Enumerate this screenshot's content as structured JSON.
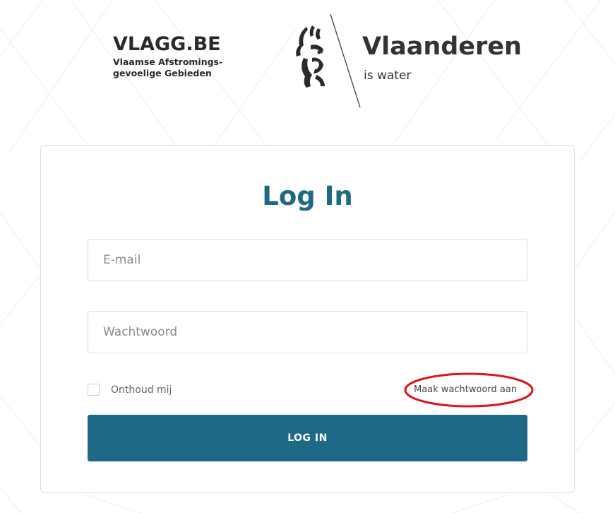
{
  "brand": {
    "vlagg_title": "VLAGG.BE",
    "vlagg_subtitle_line1": "Vlaamse Afstromings-",
    "vlagg_subtitle_line2": "gevoelige Gebieden",
    "vlaanderen_title": "Vlaanderen",
    "vlaanderen_subtitle": "is water"
  },
  "login": {
    "title": "Log In",
    "email_placeholder": "E-mail",
    "password_placeholder": "Wachtwoord",
    "remember_label": "Onthoud mij",
    "forgot_link": "Maak wachtwoord aan",
    "submit_label": "LOG IN"
  },
  "colors": {
    "accent": "#1e6a86",
    "annotation": "#e0121b"
  }
}
